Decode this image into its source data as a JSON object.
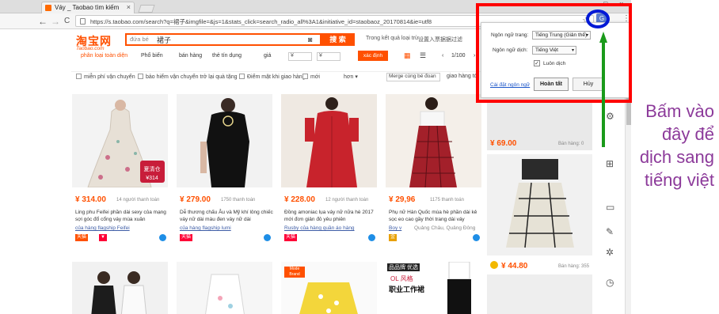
{
  "browser": {
    "tab_title": "Váy _ Taobao tìm kiếm",
    "tab_close": "×",
    "url": "https://s.taobao.com/search?q=裙子&imgfile=&js=1&stats_click=search_radio_all%3A1&initiative_id=staobaoz_20170814&ie=utf8",
    "back": "←",
    "forward": "→",
    "reload": "C",
    "bookmark_star": "☆",
    "menu": "⋮",
    "window_controls": [
      "–",
      "□",
      "×"
    ],
    "translate_icon": "G"
  },
  "taobao": {
    "logo": "淘宝网",
    "logo_sub": "Taobao.com",
    "search_scope": "đứa bé",
    "search_value": "裙子",
    "search_button": "搜 索",
    "global_label": "Trong kết quả loại trừ",
    "global_sub": "设置入票据据过滤",
    "filter_tabs": [
      "phân loại toàn diện",
      "Phổ biến",
      "bán hàng",
      "thẻ tín dụng",
      "giá"
    ],
    "price_from": "¥",
    "price_to": "¥",
    "confirm_button": "xác định",
    "pager": "1/100",
    "options": [
      "miễn phí vận chuyển",
      "bảo hiểm vận chuyển trở lại quà tặng",
      "Điểm mặt khi giao hàng",
      "mới",
      "hơn"
    ],
    "merge_label": "Merge cùng bé đoan",
    "ship_label": "giao hàng tới"
  },
  "products": [
    {
      "price": "¥ 314.00",
      "sold": "14 người thanh toán",
      "title": "Ling phu Feifei phần dài sexy của mạng sợi góc đổ cổng váy mùa xuân",
      "shop": "của hàng flagship Feifei",
      "badge": "天猫",
      "badge_color": "#ff0036"
    },
    {
      "price": "¥ 279.00",
      "sold": "1750 thanh toán",
      "title": "Dễ thương chấu Âu và Mỹ khí lông chiếc váy nữ dài màu đen váy nữ dài",
      "shop": "của hàng flagship lumi",
      "badge": "天猫",
      "badge_color": "#ff0036"
    },
    {
      "price": "¥ 228.00",
      "sold": "12 người thanh toán",
      "title": "Đồng amoniac lụa váy nữ nữa hè 2017 mới đơn giản đỏ yêu phiên",
      "shop": "Rusby của hàng quần áo hàng",
      "badge": "天猫",
      "badge_color": "#ff0036"
    },
    {
      "price": "¥ 29,96",
      "sold": "1175 thanh toán",
      "title": "Phụ nữ Hàn Quốc mùa hè phần dài kẻ sọc eo cao gầy thời trang dài váy",
      "shop": "Boy v",
      "location": "Quảng Châu, Quảng Đông",
      "badge": "金",
      "badge_color": "#e8a000"
    }
  ],
  "right_products": [
    {
      "price": "¥ 69.00",
      "sold": "Bán hàng: 0"
    },
    {
      "price": "¥ 44.80",
      "sold": "Bán hàng: 355"
    }
  ],
  "bottom_labels": {
    "third": "Mode Brand",
    "fourth_1": "品品牌 优选",
    "fourth_2": "OL 风格",
    "fourth_3": "职业工作裙"
  },
  "popup": {
    "page_lang_label": "Ngôn ngữ trang:",
    "page_lang_value": "Tiếng Trung (Giản thể)",
    "target_lang_label": "Ngôn ngữ dịch:",
    "target_lang_value": "Tiếng Việt",
    "always_translate": "Luôn dịch",
    "settings_link": "Cài đặt ngôn ngữ",
    "done_button": "Hoàn tất",
    "cancel_button": "Hủy"
  },
  "annotation": {
    "line1": "Bấm vào",
    "line2": "đây để",
    "line3": "dịch sang",
    "line4": "tiếng việt"
  },
  "colors": {
    "taobao_orange": "#ff5000",
    "highlight_red": "#ff0000",
    "highlight_blue": "#0019d6",
    "arrow_green": "#1a9a1a",
    "annotation_purple": "#8c3a9a"
  }
}
